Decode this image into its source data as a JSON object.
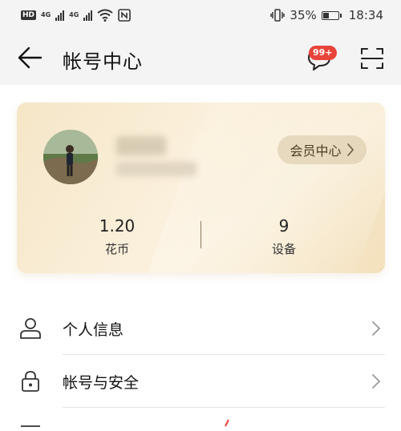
{
  "status_bar": {
    "hd_badge": "HD",
    "network_1": "4G",
    "network_2": "4G",
    "battery_percent": "35%",
    "time": "18:34"
  },
  "header": {
    "title": "帐号中心",
    "message_badge": "99+"
  },
  "account_card": {
    "member_center_label": "会员中心",
    "stats": [
      {
        "value": "1.20",
        "label": "花币"
      },
      {
        "value": "9",
        "label": "设备"
      }
    ]
  },
  "menu": {
    "items": [
      {
        "label": "个人信息",
        "icon": "person-icon"
      },
      {
        "label": "帐号与安全",
        "icon": "lock-icon"
      }
    ]
  },
  "colors": {
    "badge": "#e8443a",
    "card_gold": "#f5e6c7",
    "background": "#f4f4f4"
  }
}
